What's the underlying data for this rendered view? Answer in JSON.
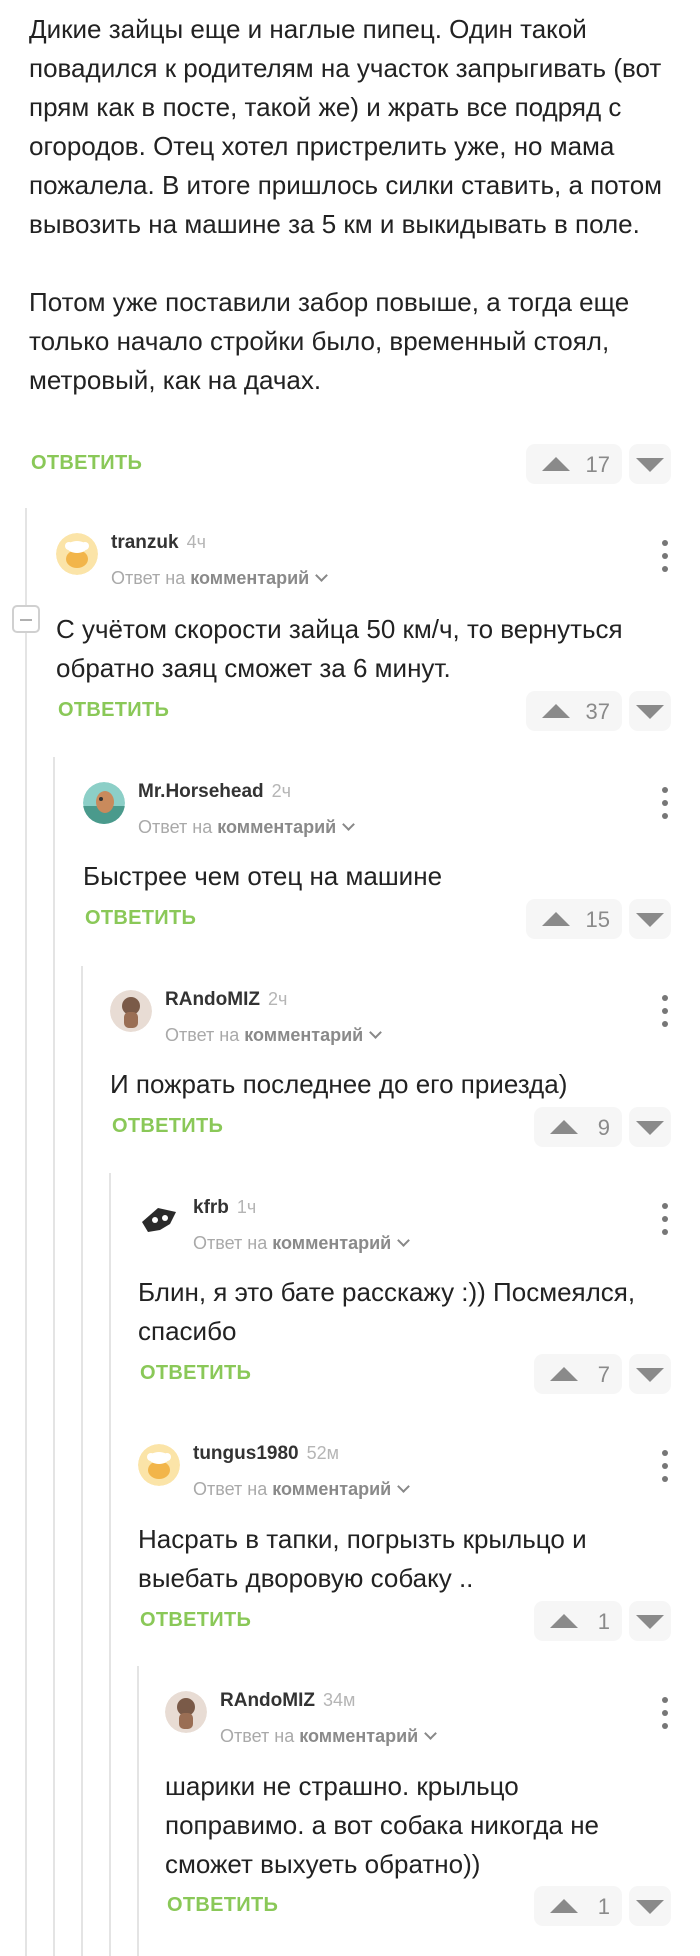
{
  "root_comment": {
    "text": "Дикие зайцы еще и наглые пипец. Один такой повадился к родителям на участок запрыгивать (вот прям как в посте, такой же) и жрать все подряд с огородов. Отец хотел пристрелить уже, но мама пожалела. В итоге пришлось силки ставить, а потом вывозить на машине за 5 км и выкидывать в поле.\n\nПотом уже поставили забор повыше, а тогда еще только начало стройки было, временный стоял, метровый, как на дачах.",
    "reply_label": "ОТВЕТИТЬ",
    "votes": "17"
  },
  "reply_to_prefix": "Ответ на",
  "reply_to_target": "комментарий",
  "comments": [
    {
      "user": "tranzuk",
      "time": "4ч",
      "text": "С учётом скорости зайца 50 км/ч, то вернуться обратно заяц сможет за 6 минут.",
      "reply_label": "ОТВЕТИТЬ",
      "votes": "37",
      "avatar": "chef-hat-avatar"
    },
    {
      "user": "Mr.Horsehead",
      "time": "2ч",
      "text": "Быстрее чем отец на машине",
      "reply_label": "ОТВЕТИТЬ",
      "votes": "15",
      "avatar": "photo-avatar"
    },
    {
      "user": "RAndoMIZ",
      "time": "2ч",
      "text": "И пожрать последнее до его приезда)",
      "reply_label": "ОТВЕТИТЬ",
      "votes": "9",
      "avatar": "photo-avatar"
    },
    {
      "user": "kfrb",
      "time": "1ч",
      "text": "Блин, я это бате расскажу :)) Посмеялся, спасибо",
      "reply_label": "ОТВЕТИТЬ",
      "votes": "7",
      "avatar": "mask-avatar"
    },
    {
      "user": "tungus1980",
      "time": "52м",
      "text": "Насрать в тапки, погрызть крыльцо и выебать дворовую собаку ..",
      "reply_label": "ОТВЕТИТЬ",
      "votes": "1",
      "avatar": "chef-hat-avatar"
    },
    {
      "user": "RAndoMIZ",
      "time": "34м",
      "text": "шарики не страшно. крыльцо поправимо. а вот собака никогда не сможет выхуеть обратно))",
      "reply_label": "ОТВЕТИТЬ",
      "votes": "1",
      "avatar": "photo-avatar"
    }
  ],
  "colors": {
    "accent_reply": "#8ac858",
    "vote_bg": "#f6f6f6",
    "thread_line": "#e4e4e4"
  }
}
